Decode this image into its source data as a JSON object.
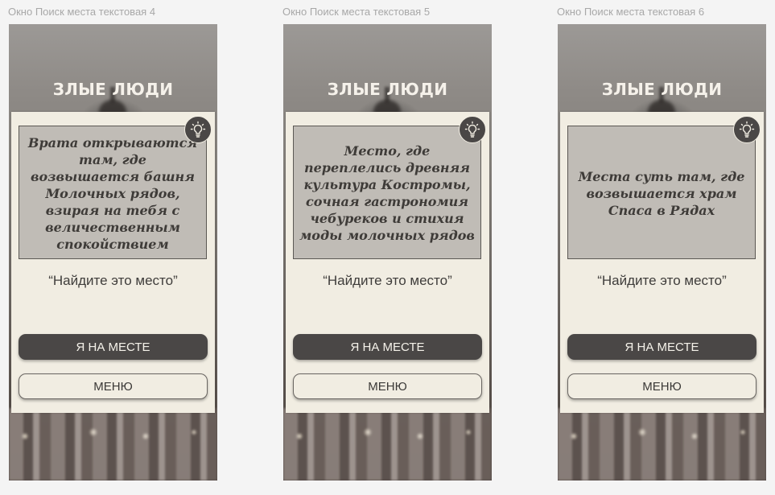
{
  "frames": [
    {
      "label": "Окно Поиск места текстовая 4",
      "title": "ЗЛЫЕ ЛЮДИ",
      "riddle": "Врата открываются там, где возвышается башня Молочных рядов, взирая на тебя с величественным спокойствием",
      "prompt": "“Найдите это место”",
      "primary_button": "Я НА МЕСТЕ",
      "secondary_button": "МЕНЮ",
      "hint_icon": "lightbulb-icon"
    },
    {
      "label": "Окно Поиск места текстовая 5",
      "title": "ЗЛЫЕ ЛЮДИ",
      "riddle": "Место, где переплелись древняя культура Костромы, сочная гастрономия чебуреков и стихия моды молочных рядов",
      "prompt": "“Найдите это место”",
      "primary_button": "Я НА МЕСТЕ",
      "secondary_button": "МЕНЮ",
      "hint_icon": "lightbulb-icon"
    },
    {
      "label": "Окно Поиск места текстовая 6",
      "title": "ЗЛЫЕ ЛЮДИ",
      "riddle": "Места суть там, где возвышается храм Спаса в Рядах",
      "prompt": "“Найдите это место”",
      "primary_button": "Я НА МЕСТЕ",
      "secondary_button": "МЕНЮ",
      "hint_icon": "lightbulb-icon"
    }
  ],
  "colors": {
    "card_bg": "#f1ede2",
    "riddle_bg": "#c0bcb6",
    "primary_btn": "#4a4746",
    "text_dark": "#3e3b38"
  }
}
